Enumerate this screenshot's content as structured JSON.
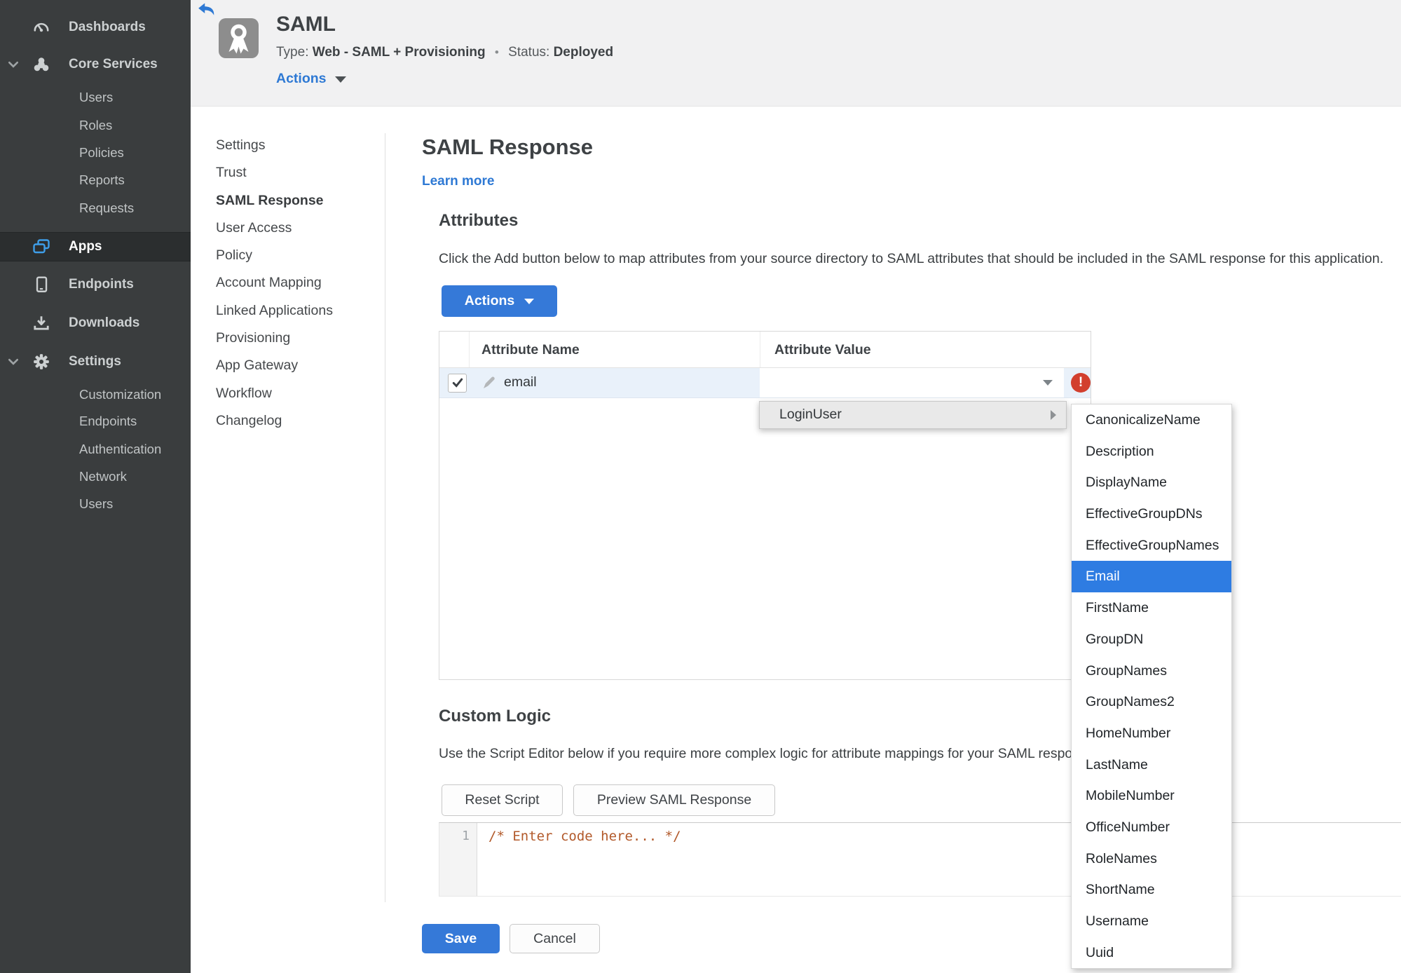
{
  "colors": {
    "accent_blue": "#3579d8",
    "link_blue": "#2e79d4",
    "status_green": "#478d27",
    "error_red": "#d23f2e",
    "selection_blue": "#2e7ce2",
    "sidebar_bg": "#3a3d3e",
    "row_highlight": "#e9f1fa",
    "code_comment_color": "#b2592a",
    "apps_icon_blue": "#3e9ee9"
  },
  "sidebar": {
    "items": [
      {
        "label": "Dashboards",
        "icon": "gauge-icon"
      },
      {
        "label": "Core Services",
        "icon": "core-services-icon",
        "expanded": true
      },
      {
        "label": "Users",
        "child": true
      },
      {
        "label": "Roles",
        "child": true
      },
      {
        "label": "Policies",
        "child": true
      },
      {
        "label": "Reports",
        "child": true
      },
      {
        "label": "Requests",
        "child": true
      },
      {
        "label": "Apps",
        "icon": "apps-icon",
        "active": true
      },
      {
        "label": "Endpoints",
        "icon": "tablet-icon"
      },
      {
        "label": "Downloads",
        "icon": "download-icon"
      },
      {
        "label": "Settings",
        "icon": "gear-icon",
        "expanded": true
      },
      {
        "label": "Customization",
        "child": true
      },
      {
        "label": "Endpoints",
        "child": true
      },
      {
        "label": "Authentication",
        "child": true
      },
      {
        "label": "Network",
        "child": true
      },
      {
        "label": "Users",
        "child": true
      }
    ]
  },
  "header": {
    "app_title": "SAML",
    "type_label": "Type:",
    "type_value": "Web - SAML + Provisioning",
    "separator": "•",
    "status_label": "Status:",
    "status_value": "Deployed",
    "actions_label": "Actions",
    "app_icon": "ribbon-medal-icon",
    "back_icon": "back-arrow-icon"
  },
  "subnav": {
    "items": [
      {
        "label": "Settings"
      },
      {
        "label": "Trust"
      },
      {
        "label": "SAML Response",
        "active": true
      },
      {
        "label": "User Access"
      },
      {
        "label": "Policy"
      },
      {
        "label": "Account Mapping"
      },
      {
        "label": "Linked Applications"
      },
      {
        "label": "Provisioning"
      },
      {
        "label": "App Gateway"
      },
      {
        "label": "Workflow"
      },
      {
        "label": "Changelog"
      }
    ]
  },
  "main": {
    "title": "SAML Response",
    "learn_more": "Learn more",
    "attributes": {
      "heading": "Attributes",
      "description": "Click the Add button below to map attributes from your source directory to SAML attributes that should be included in the SAML response for this application.",
      "actions_button": "Actions",
      "table": {
        "columns": [
          "Attribute Name",
          "Attribute Value"
        ],
        "rows": [
          {
            "checked": true,
            "attribute_name": "email",
            "attribute_value": "",
            "error": true
          }
        ]
      }
    },
    "value_menu": {
      "item": "LoginUser",
      "submenu": [
        "CanonicalizeName",
        "Description",
        "DisplayName",
        "EffectiveGroupDNs",
        "EffectiveGroupNames",
        "Email",
        "FirstName",
        "GroupDN",
        "GroupNames",
        "GroupNames2",
        "HomeNumber",
        "LastName",
        "MobileNumber",
        "OfficeNumber",
        "RoleNames",
        "ShortName",
        "Username",
        "Uuid"
      ],
      "selected": "Email"
    },
    "custom_logic": {
      "heading": "Custom Logic",
      "description": "Use the Script Editor below if you require more complex logic for attribute mappings for your SAML response.",
      "reset_button": "Reset Script",
      "preview_button": "Preview SAML Response"
    },
    "editor": {
      "line_number": "1",
      "code": "/* Enter code here... */"
    },
    "footer": {
      "save": "Save",
      "cancel": "Cancel"
    }
  }
}
